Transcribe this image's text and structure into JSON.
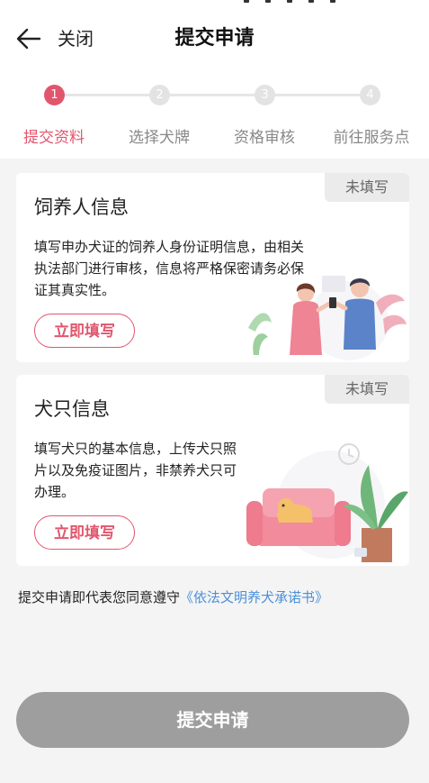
{
  "header": {
    "back_label": "关闭",
    "title": "提交申请"
  },
  "steps": [
    {
      "num": "1",
      "label": "提交资料",
      "active": true
    },
    {
      "num": "2",
      "label": "选择犬牌",
      "active": false
    },
    {
      "num": "3",
      "label": "资格审核",
      "active": false
    },
    {
      "num": "4",
      "label": "前往服务点",
      "active": false
    }
  ],
  "cards": [
    {
      "title": "饲养人信息",
      "status": "未填写",
      "desc_lines": [
        "填写申办犬证的饲养人身份证明信息，由相关",
        "执法部门进行审核，信息将严格保密请务必保",
        "证其真实性。"
      ],
      "button": "立即填写"
    },
    {
      "title": "犬只信息",
      "status": "未填写",
      "desc_lines": [
        "填写犬只的基本信息，上传犬只照",
        "片以及免疫证图片，非禁养犬只可",
        "办理。"
      ],
      "button": "立即填写"
    }
  ],
  "agreement": {
    "text": "提交申请即代表您同意遵守",
    "link": "《依法文明养犬承诺书》"
  },
  "submit_label": "提交申请",
  "colors": {
    "accent": "#e1566d",
    "link": "#4a90d9",
    "disabled": "#9e9e9e"
  }
}
